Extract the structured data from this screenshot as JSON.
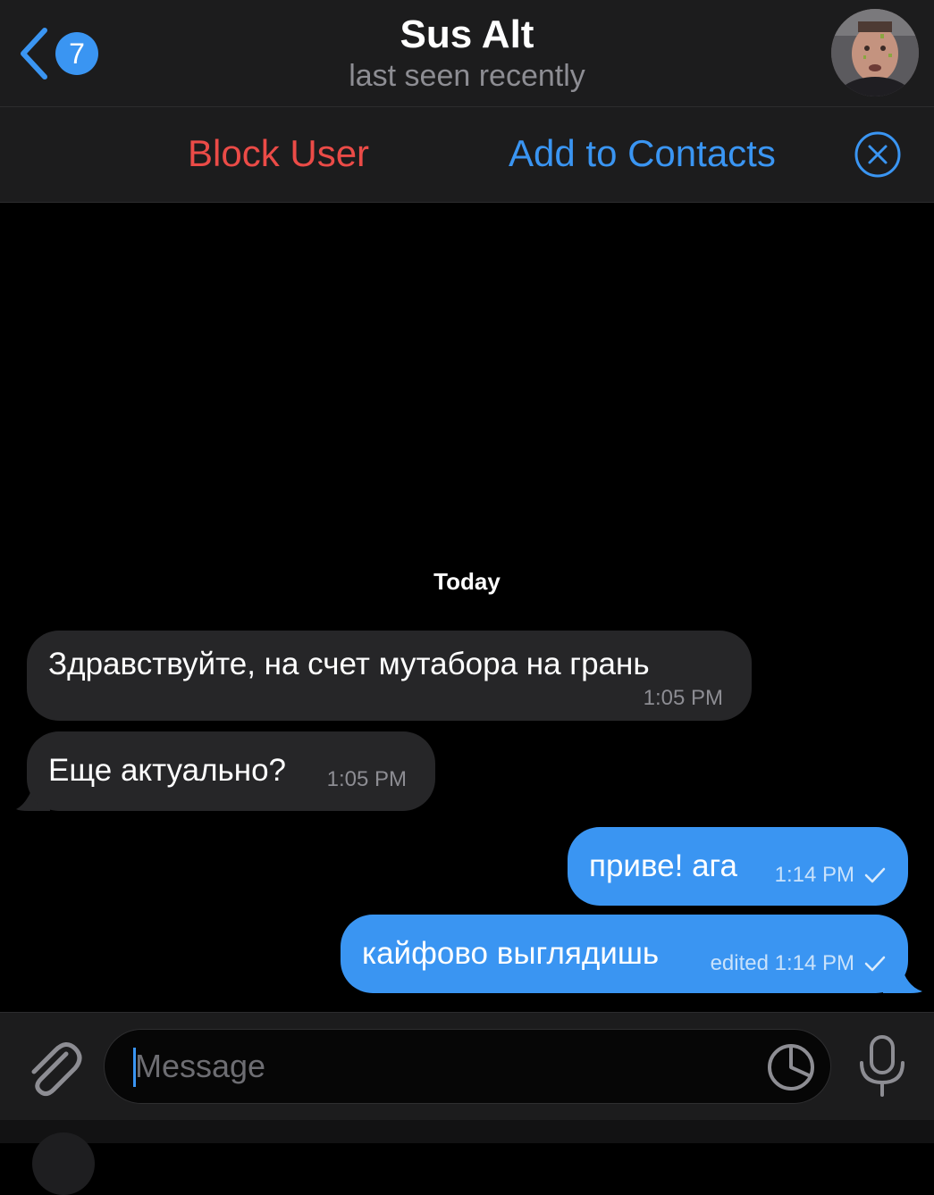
{
  "header": {
    "back_badge": "7",
    "title": "Sus Alt",
    "subtitle": "last seen recently"
  },
  "actions": {
    "block_label": "Block User",
    "add_label": "Add to Contacts"
  },
  "chat": {
    "date_label": "Today",
    "messages": [
      {
        "direction": "incoming",
        "text": "Здравствуйте, на счет мутабора на грань",
        "time": "1:05 PM"
      },
      {
        "direction": "incoming",
        "text": "Еще актуально?",
        "time": "1:05 PM"
      },
      {
        "direction": "outgoing",
        "text": "приве! ага",
        "time": "1:14 PM",
        "status": "sent"
      },
      {
        "direction": "outgoing",
        "text": "кайфово выглядишь",
        "time": "edited 1:14 PM",
        "status": "sent"
      }
    ]
  },
  "composer": {
    "placeholder": "Message"
  },
  "icons": {
    "back": "chevron-left-icon",
    "close": "close-circle-icon",
    "attach": "paperclip-icon",
    "sticker": "sticker-icon",
    "mic": "microphone-icon",
    "check": "checkmark-icon"
  },
  "colors": {
    "accent": "#3a95f2",
    "danger": "#eb4b47",
    "bar_background": "#1c1c1d",
    "incoming_bubble": "#262628",
    "outgoing_bubble": "#3a95f2",
    "secondary_text": "#8d8d93"
  }
}
